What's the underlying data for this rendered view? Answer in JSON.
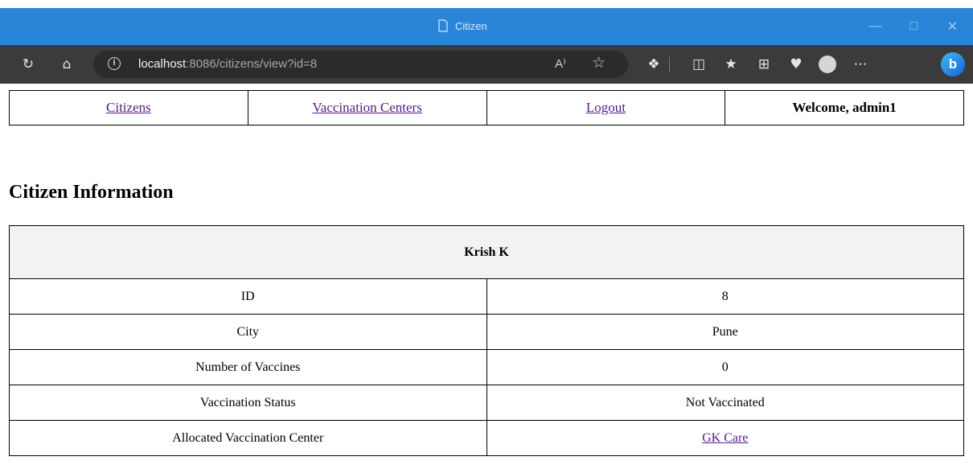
{
  "window": {
    "title": "Citizen",
    "controls": [
      "minimize-icon",
      "maximize-icon",
      "close-icon"
    ]
  },
  "toolbar": {
    "url_host": "localhost",
    "url_rest": ":8086/citizens/view?id=8",
    "read_aloud_label": "A⁾"
  },
  "nav": {
    "citizens": "Citizens",
    "vaccination_centers": "Vaccination Centers",
    "logout": "Logout",
    "welcome": "Welcome, admin1"
  },
  "page": {
    "heading": "Citizen Information"
  },
  "citizen": {
    "name": "Krish K",
    "rows": [
      {
        "label": "ID",
        "value": "8"
      },
      {
        "label": "City",
        "value": "Pune"
      },
      {
        "label": "Number of Vaccines",
        "value": "0"
      },
      {
        "label": "Vaccination Status",
        "value": "Not Vaccinated"
      },
      {
        "label": "Allocated Vaccination Center",
        "value": "GK Care"
      }
    ]
  },
  "colors": {
    "titlebar": "#2a84d8",
    "toolbar": "#3b3b3b",
    "visited_link": "#551a8b",
    "header_bg": "#f2f2f2"
  }
}
